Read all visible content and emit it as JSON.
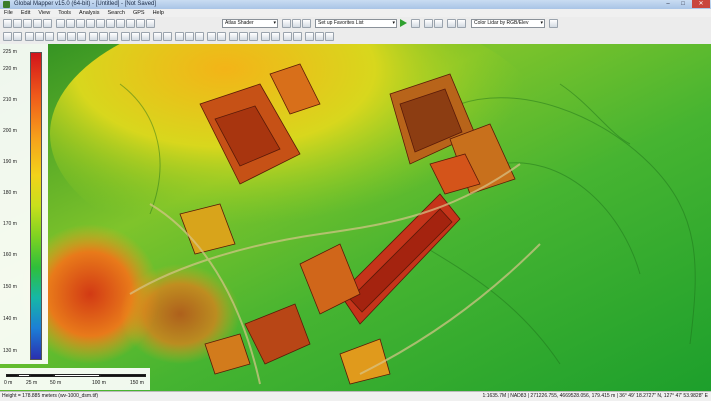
{
  "titlebar": {
    "title": "Global Mapper v15.0 (64-bit) - [Untitled] - [Not Saved]",
    "min_label": "–",
    "max_label": "□",
    "close_label": "✕"
  },
  "menu": [
    "File",
    "Edit",
    "View",
    "Tools",
    "Analysis",
    "Search",
    "GPS",
    "Help"
  ],
  "toolbar": {
    "shader": "Atlas Shader",
    "favorites": "Set up Favorites List",
    "lidar_color": "Color Lidar by RGB/Elev"
  },
  "legend": {
    "labels": [
      "225 m",
      "220 m",
      "210 m",
      "200 m",
      "190 m",
      "180 m",
      "170 m",
      "160 m",
      "150 m",
      "140 m",
      "130 m"
    ]
  },
  "scalebar": {
    "labels": [
      "0 m",
      "25 m",
      "50 m",
      "100 m",
      "150 m"
    ]
  },
  "status": {
    "left": "Height = 178.885 meters (wv-1000_dsm.tif)",
    "right": "1:1635.7M | NAD83 | 271226.755, 4669528.056, 179.415 m | 36° 49' 18.2727\" N, 127° 47' 53.9828\" E"
  },
  "colors": {
    "hi": "#d1141b",
    "mid": "#f2d31a",
    "lo": "#2a2fb0"
  }
}
